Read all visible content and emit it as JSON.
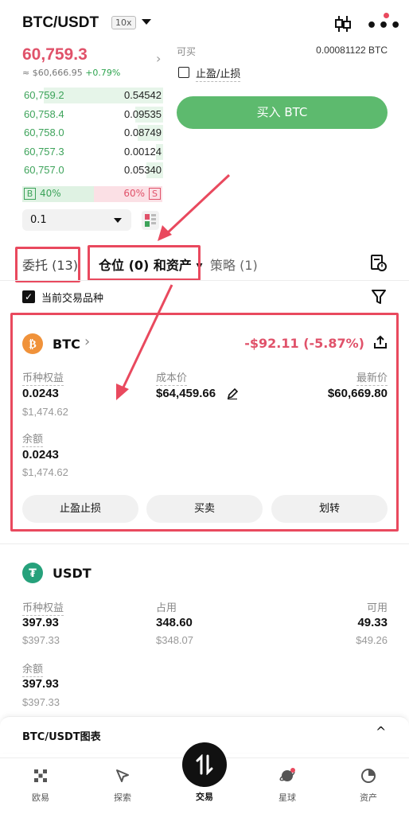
{
  "header": {
    "pair": "BTC/USDT",
    "leverage": "10x",
    "price": "60,759.3",
    "sub_price": "≈ $60,666.95",
    "sub_change": "+0.79%"
  },
  "orderbook": {
    "rows": [
      {
        "price": "60,759.2",
        "qty": "0.54542",
        "depth": 0.85
      },
      {
        "price": "60,758.4",
        "qty": "0.09535",
        "depth": 0.2
      },
      {
        "price": "60,758.0",
        "qty": "0.08749",
        "depth": 0.18
      },
      {
        "price": "60,757.3",
        "qty": "0.00124",
        "depth": 0.05
      },
      {
        "price": "60,757.0",
        "qty": "0.05340",
        "depth": 0.12
      }
    ],
    "buy_label": "B",
    "buy_pct": "40%",
    "sell_label": "S",
    "sell_pct": "60%",
    "qty_select": "0.1"
  },
  "trade": {
    "available_label": "可买",
    "available_value": "0.00081122 BTC",
    "tpsl_label": "止盈/止损",
    "buy_button": "买入 BTC"
  },
  "tabs": {
    "orders": "委托 (13)",
    "positions": "仓位 (0) 和资产",
    "strategy": "策略 (1)"
  },
  "filter": {
    "current_only": "当前交易品种"
  },
  "btc": {
    "name": "BTC",
    "pnl": "-$92.11 (-5.87%)",
    "equity_label": "币种权益",
    "equity": "0.0243",
    "equity_usd": "$1,474.62",
    "cost_label": "成本价",
    "cost": "$64,459.66",
    "last_label": "最新价",
    "last": "$60,669.80",
    "balance_label": "余额",
    "balance": "0.0243",
    "balance_usd": "$1,474.62",
    "btn_tpsl": "止盈止损",
    "btn_trade": "买卖",
    "btn_transfer": "划转"
  },
  "usdt": {
    "name": "USDT",
    "equity_label": "币种权益",
    "equity": "397.93",
    "equity_usd": "$397.33",
    "used_label": "占用",
    "used": "348.60",
    "used_usd": "$348.07",
    "avail_label": "可用",
    "avail": "49.33",
    "avail_usd": "$49.26",
    "balance_label": "余额",
    "balance": "397.93",
    "balance_usd": "$397.33"
  },
  "chart_bar": {
    "label": "BTC/USDT图表"
  },
  "nav": {
    "items": [
      "欧易",
      "探索",
      "交易",
      "星球",
      "资产"
    ]
  },
  "colors": {
    "red": "#e0526a",
    "green": "#3da35a",
    "highlight": "#e9495e",
    "buy_btn": "#5dba6e"
  }
}
